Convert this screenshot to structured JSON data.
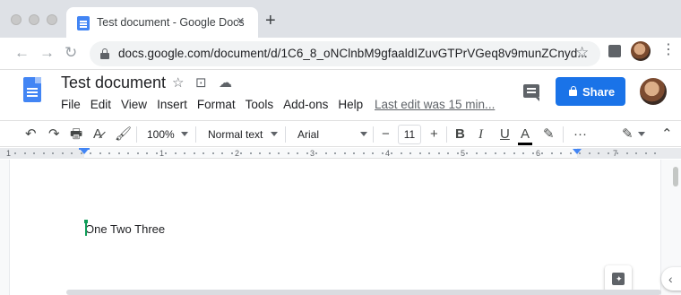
{
  "browser": {
    "tab_title": "Test document - Google Docs",
    "tab_close": "×",
    "new_tab": "+",
    "nav_back": "←",
    "nav_forward": "→",
    "nav_reload": "↻",
    "url": "docs.google.com/document/d/1C6_8_oNClnbM9gfaaldIZuvGTPrVGeq8v9munZCnyd...",
    "bookmark_star": "☆",
    "menu_kebab": "⋮"
  },
  "docs": {
    "title": "Test document",
    "title_star": "☆",
    "title_move": "⊡",
    "title_cloud": "☁",
    "menu": [
      "File",
      "Edit",
      "View",
      "Insert",
      "Format",
      "Tools",
      "Add-ons",
      "Help"
    ],
    "last_edit": "Last edit was 15 min...",
    "share_label": "Share"
  },
  "format_toolbar": {
    "undo": "↶",
    "redo": "↷",
    "print": "🖶",
    "spellcheck": "A̷",
    "paint_format": "🖌",
    "zoom": "100%",
    "style": "Normal text",
    "font": "Arial",
    "decrease": "−",
    "font_size": "11",
    "increase": "+",
    "bold": "B",
    "italic": "I",
    "underline": "U",
    "text_color": "A",
    "highlight": "✎",
    "more": "···",
    "editing_mode": "✎",
    "collapse": "⌃"
  },
  "ruler": {
    "numbers": [
      "1",
      "1",
      "2",
      "3",
      "4",
      "5",
      "6",
      "7"
    ]
  },
  "document": {
    "body_text": "One Two Three"
  },
  "side_toggle": "‹",
  "colors": {
    "accent_blue": "#1a73e8",
    "docs_blue": "#4285f4",
    "cursor_green": "#0f9d58"
  }
}
